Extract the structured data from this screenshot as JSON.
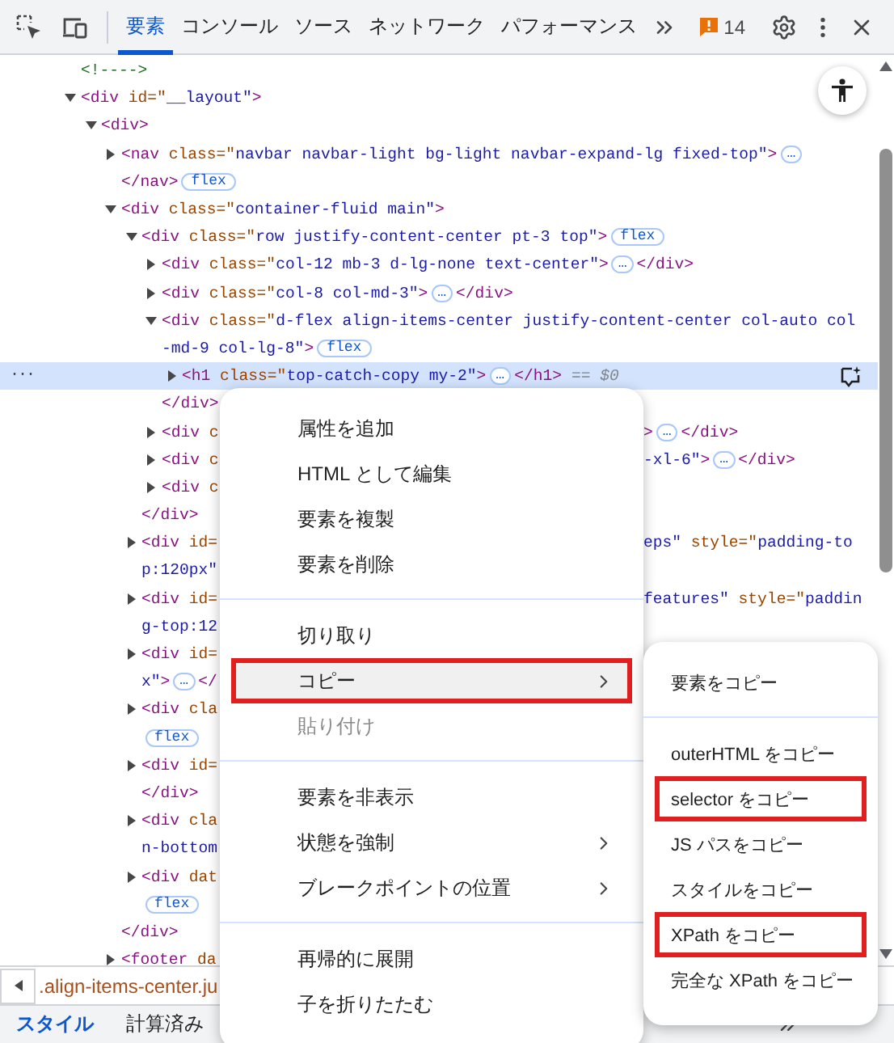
{
  "toolbar": {
    "tabs": [
      {
        "label": "要素",
        "selected": true
      },
      {
        "label": "コンソール",
        "selected": false
      },
      {
        "label": "ソース",
        "selected": false
      },
      {
        "label": "ネットワーク",
        "selected": false
      },
      {
        "label": "パフォーマンス",
        "selected": false
      }
    ],
    "issues": "14"
  },
  "tree": [
    {
      "selected": false,
      "line": [
        {
          "kind": "comment",
          "text": "<!---->"
        }
      ]
    },
    {
      "selected": false,
      "expanded": true,
      "line": [
        {
          "kind": "tag",
          "text": "<div "
        },
        {
          "kind": "attr",
          "text": "id=\""
        },
        {
          "kind": "value",
          "text": "__layout\""
        },
        {
          "kind": "tag",
          "text": ">"
        }
      ],
      "children": [
        {
          "selected": false,
          "expanded": true,
          "line": [
            {
              "kind": "tag",
              "text": "<div>"
            }
          ],
          "children": [
            {
              "selected": false,
              "expanded": false,
              "line": [
                {
                  "kind": "tag",
                  "text": "<nav "
                },
                {
                  "kind": "attr",
                  "text": "class=\""
                },
                {
                  "kind": "value",
                  "text": "navbar navbar-light bg-light navbar-expand-lg fixed-top\""
                },
                {
                  "kind": "tag",
                  "text": ">"
                },
                {
                  "kind": "ellipsis",
                  "text": "…"
                }
              ],
              "wrap": [
                {
                  "kind": "tag",
                  "text": "</nav>"
                },
                {
                  "kind": "flex",
                  "text": "flex"
                }
              ]
            },
            {
              "selected": false,
              "expanded": true,
              "line": [
                {
                  "kind": "tag",
                  "text": "<div "
                },
                {
                  "kind": "attr",
                  "text": "class=\""
                },
                {
                  "kind": "value",
                  "text": "container-fluid main\""
                },
                {
                  "kind": "tag",
                  "text": ">"
                }
              ],
              "children": [
                {
                  "selected": false,
                  "expanded": true,
                  "line": [
                    {
                      "kind": "tag",
                      "text": "<div "
                    },
                    {
                      "kind": "attr",
                      "text": "class=\""
                    },
                    {
                      "kind": "value",
                      "text": "row justify-content-center pt-3 top\""
                    },
                    {
                      "kind": "tag",
                      "text": ">"
                    },
                    {
                      "kind": "flex",
                      "text": "flex"
                    }
                  ],
                  "children": [
                    {
                      "selected": false,
                      "expanded": false,
                      "line": [
                        {
                          "kind": "tag",
                          "text": "<div "
                        },
                        {
                          "kind": "attr",
                          "text": "class=\""
                        },
                        {
                          "kind": "value",
                          "text": "col-12 mb-3 d-lg-none text-center\""
                        },
                        {
                          "kind": "tag",
                          "text": ">"
                        },
                        {
                          "kind": "ellipsis",
                          "text": "…"
                        },
                        {
                          "kind": "tag",
                          "text": "</div>"
                        }
                      ]
                    },
                    {
                      "selected": false,
                      "expanded": false,
                      "line": [
                        {
                          "kind": "tag",
                          "text": "<div "
                        },
                        {
                          "kind": "attr",
                          "text": "class=\""
                        },
                        {
                          "kind": "value",
                          "text": "col-8 col-md-3\""
                        },
                        {
                          "kind": "tag",
                          "text": ">"
                        },
                        {
                          "kind": "ellipsis",
                          "text": "…"
                        },
                        {
                          "kind": "tag",
                          "text": "</div>"
                        }
                      ]
                    },
                    {
                      "selected": false,
                      "expanded": true,
                      "line": [
                        {
                          "kind": "tag",
                          "text": "<div "
                        },
                        {
                          "kind": "attr",
                          "text": "class=\""
                        },
                        {
                          "kind": "value",
                          "text": "d-flex align-items-center justify-content-center col-auto col"
                        }
                      ],
                      "wrap": [
                        {
                          "kind": "value",
                          "text": "-md-9 col-lg-8\""
                        },
                        {
                          "kind": "tag",
                          "text": ">"
                        },
                        {
                          "kind": "flex",
                          "text": "flex"
                        }
                      ],
                      "children": [
                        {
                          "selected": true,
                          "expanded": false,
                          "gutter": "···",
                          "line": [
                            {
                              "kind": "tag",
                              "text": "<h1 "
                            },
                            {
                              "kind": "attr",
                              "text": "class=\""
                            },
                            {
                              "kind": "value",
                              "text": "top-catch-copy my-2\""
                            },
                            {
                              "kind": "tag",
                              "text": ">"
                            },
                            {
                              "kind": "ellipsis",
                              "text": "…"
                            },
                            {
                              "kind": "tag",
                              "text": "</h1>"
                            },
                            {
                              "kind": "note",
                              "text": "== $0"
                            }
                          ]
                        }
                      ],
                      "closing": [
                        {
                          "kind": "tag",
                          "text": "</div>"
                        }
                      ]
                    },
                    {
                      "selected": false,
                      "expanded": false,
                      "line": [
                        {
                          "kind": "tag",
                          "text": "<div "
                        },
                        {
                          "kind": "attr",
                          "text": "c"
                        }
                      ],
                      "right": [
                        {
                          "kind": "tag",
                          "text": ">"
                        },
                        {
                          "kind": "ellipsis",
                          "text": "…"
                        },
                        {
                          "kind": "tag",
                          "text": "</div>"
                        }
                      ]
                    },
                    {
                      "selected": false,
                      "expanded": false,
                      "line": [
                        {
                          "kind": "tag",
                          "text": "<div "
                        },
                        {
                          "kind": "attr",
                          "text": "c"
                        }
                      ],
                      "right": [
                        {
                          "kind": "value",
                          "text": "-xl-6\""
                        },
                        {
                          "kind": "tag",
                          "text": ">"
                        },
                        {
                          "kind": "ellipsis",
                          "text": "…"
                        },
                        {
                          "kind": "tag",
                          "text": "</div>"
                        }
                      ]
                    },
                    {
                      "selected": false,
                      "expanded": false,
                      "line": [
                        {
                          "kind": "tag",
                          "text": "<div "
                        },
                        {
                          "kind": "attr",
                          "text": "c"
                        }
                      ]
                    }
                  ],
                  "closing": [
                    {
                      "kind": "tag",
                      "text": "</div>"
                    }
                  ]
                },
                {
                  "selected": false,
                  "expanded": false,
                  "line": [
                    {
                      "kind": "tag",
                      "text": "<div "
                    },
                    {
                      "kind": "attr",
                      "text": "id="
                    }
                  ],
                  "right": [
                    {
                      "kind": "value",
                      "text": "eps\""
                    },
                    {
                      "kind": "attr",
                      "text": " style=\""
                    },
                    {
                      "kind": "value",
                      "text": "padding-to"
                    }
                  ],
                  "wrap": [
                    {
                      "kind": "value",
                      "text": "p:120px\""
                    }
                  ]
                },
                {
                  "selected": false,
                  "expanded": false,
                  "line": [
                    {
                      "kind": "tag",
                      "text": "<div "
                    },
                    {
                      "kind": "attr",
                      "text": "id="
                    }
                  ],
                  "right": [
                    {
                      "kind": "value",
                      "text": "features\""
                    },
                    {
                      "kind": "attr",
                      "text": " style=\""
                    },
                    {
                      "kind": "value",
                      "text": "paddin"
                    }
                  ],
                  "wrap": [
                    {
                      "kind": "value",
                      "text": "g-top:12"
                    }
                  ]
                },
                {
                  "selected": false,
                  "expanded": false,
                  "line": [
                    {
                      "kind": "tag",
                      "text": "<div "
                    },
                    {
                      "kind": "attr",
                      "text": "id="
                    }
                  ],
                  "wrap": [
                    {
                      "kind": "value",
                      "text": "x\""
                    },
                    {
                      "kind": "tag",
                      "text": ">"
                    },
                    {
                      "kind": "ellipsis",
                      "text": "…"
                    },
                    {
                      "kind": "tag",
                      "text": "</"
                    }
                  ]
                },
                {
                  "selected": false,
                  "expanded": false,
                  "line": [
                    {
                      "kind": "tag",
                      "text": "<div "
                    },
                    {
                      "kind": "attr",
                      "text": "cla"
                    }
                  ],
                  "wrap": [
                    {
                      "kind": "flex",
                      "text": "flex"
                    }
                  ]
                },
                {
                  "selected": false,
                  "expanded": false,
                  "line": [
                    {
                      "kind": "tag",
                      "text": "<div "
                    },
                    {
                      "kind": "attr",
                      "text": "id="
                    }
                  ],
                  "wrap": [
                    {
                      "kind": "tag",
                      "text": "</div>"
                    }
                  ]
                },
                {
                  "selected": false,
                  "expanded": false,
                  "line": [
                    {
                      "kind": "tag",
                      "text": "<div "
                    },
                    {
                      "kind": "attr",
                      "text": "cla"
                    }
                  ],
                  "wrap": [
                    {
                      "kind": "value",
                      "text": "n-bottom"
                    }
                  ]
                },
                {
                  "selected": false,
                  "expanded": false,
                  "line": [
                    {
                      "kind": "tag",
                      "text": "<div "
                    },
                    {
                      "kind": "attr",
                      "text": "dat"
                    }
                  ],
                  "wrap": [
                    {
                      "kind": "flex",
                      "text": "flex"
                    }
                  ]
                }
              ],
              "closing": [
                {
                  "kind": "tag",
                  "text": "</div>"
                }
              ]
            },
            {
              "selected": false,
              "expanded": false,
              "line": [
                {
                  "kind": "tag",
                  "text": "<footer "
                },
                {
                  "kind": "attr",
                  "text": "da"
                }
              ]
            }
          ]
        }
      ]
    }
  ],
  "breadcrumb": ".align-items-center.ju",
  "bottom_tabs": [
    {
      "label": "スタイル",
      "selected": true
    },
    {
      "label": "計算済み",
      "selected": false
    }
  ],
  "context_menu": {
    "groups": [
      [
        {
          "label": "属性を追加",
          "highlighted": false,
          "boxed": false,
          "disabled": false,
          "submenu": false
        },
        {
          "label": "HTML として編集",
          "highlighted": false,
          "boxed": false,
          "disabled": false,
          "submenu": false
        },
        {
          "label": "要素を複製",
          "highlighted": false,
          "boxed": false,
          "disabled": false,
          "submenu": false
        },
        {
          "label": "要素を削除",
          "highlighted": false,
          "boxed": false,
          "disabled": false,
          "submenu": false
        }
      ],
      [
        {
          "label": "切り取り",
          "highlighted": false,
          "boxed": false,
          "disabled": false,
          "submenu": false
        },
        {
          "label": "コピー",
          "highlighted": true,
          "boxed": true,
          "disabled": false,
          "submenu": true
        },
        {
          "label": "貼り付け",
          "highlighted": false,
          "boxed": false,
          "disabled": true,
          "submenu": false
        }
      ],
      [
        {
          "label": "要素を非表示",
          "highlighted": false,
          "boxed": false,
          "disabled": false,
          "submenu": false
        },
        {
          "label": "状態を強制",
          "highlighted": false,
          "boxed": false,
          "disabled": false,
          "submenu": true
        },
        {
          "label": "ブレークポイントの位置",
          "highlighted": false,
          "boxed": false,
          "disabled": false,
          "submenu": true
        }
      ],
      [
        {
          "label": "再帰的に展開",
          "highlighted": false,
          "boxed": false,
          "disabled": false,
          "submenu": false
        },
        {
          "label": "子を折りたたむ",
          "highlighted": false,
          "boxed": false,
          "disabled": false,
          "submenu": false
        }
      ]
    ]
  },
  "submenu": {
    "groups": [
      [
        {
          "label": "要素をコピー",
          "highlighted": false,
          "boxed": false
        }
      ],
      [
        {
          "label": "outerHTML をコピー",
          "highlighted": false,
          "boxed": false
        },
        {
          "label": "selector をコピー",
          "highlighted": false,
          "boxed": true
        },
        {
          "label": "JS パスをコピー",
          "highlighted": false,
          "boxed": false
        },
        {
          "label": "スタイルをコピー",
          "highlighted": false,
          "boxed": false
        },
        {
          "label": "XPath をコピー",
          "highlighted": false,
          "boxed": true
        },
        {
          "label": "完全な XPath をコピー",
          "highlighted": false,
          "boxed": false
        }
      ]
    ]
  }
}
